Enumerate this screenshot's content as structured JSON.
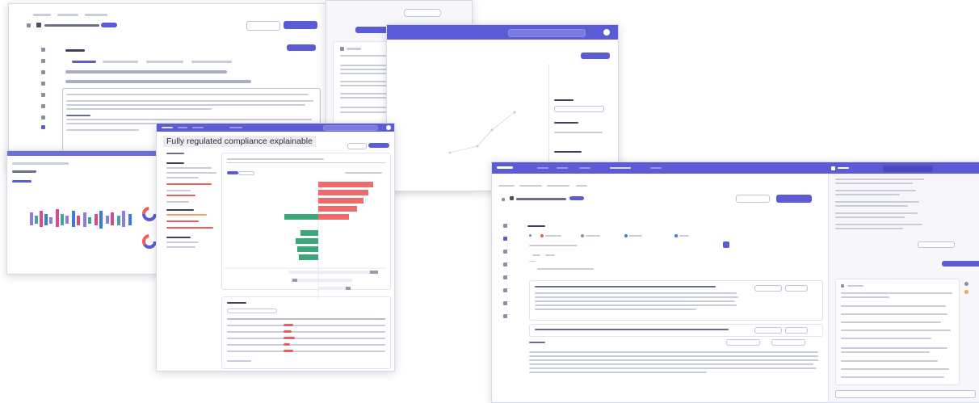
{
  "center": {
    "title": "Fully regulated compliance explainable"
  },
  "colors": {
    "accent": "#5b5bd6",
    "positive": "#3aa877",
    "negative": "#ef5a5a"
  },
  "icons": [
    "chat-icon",
    "send-icon",
    "plus-icon",
    "table-icon"
  ]
}
